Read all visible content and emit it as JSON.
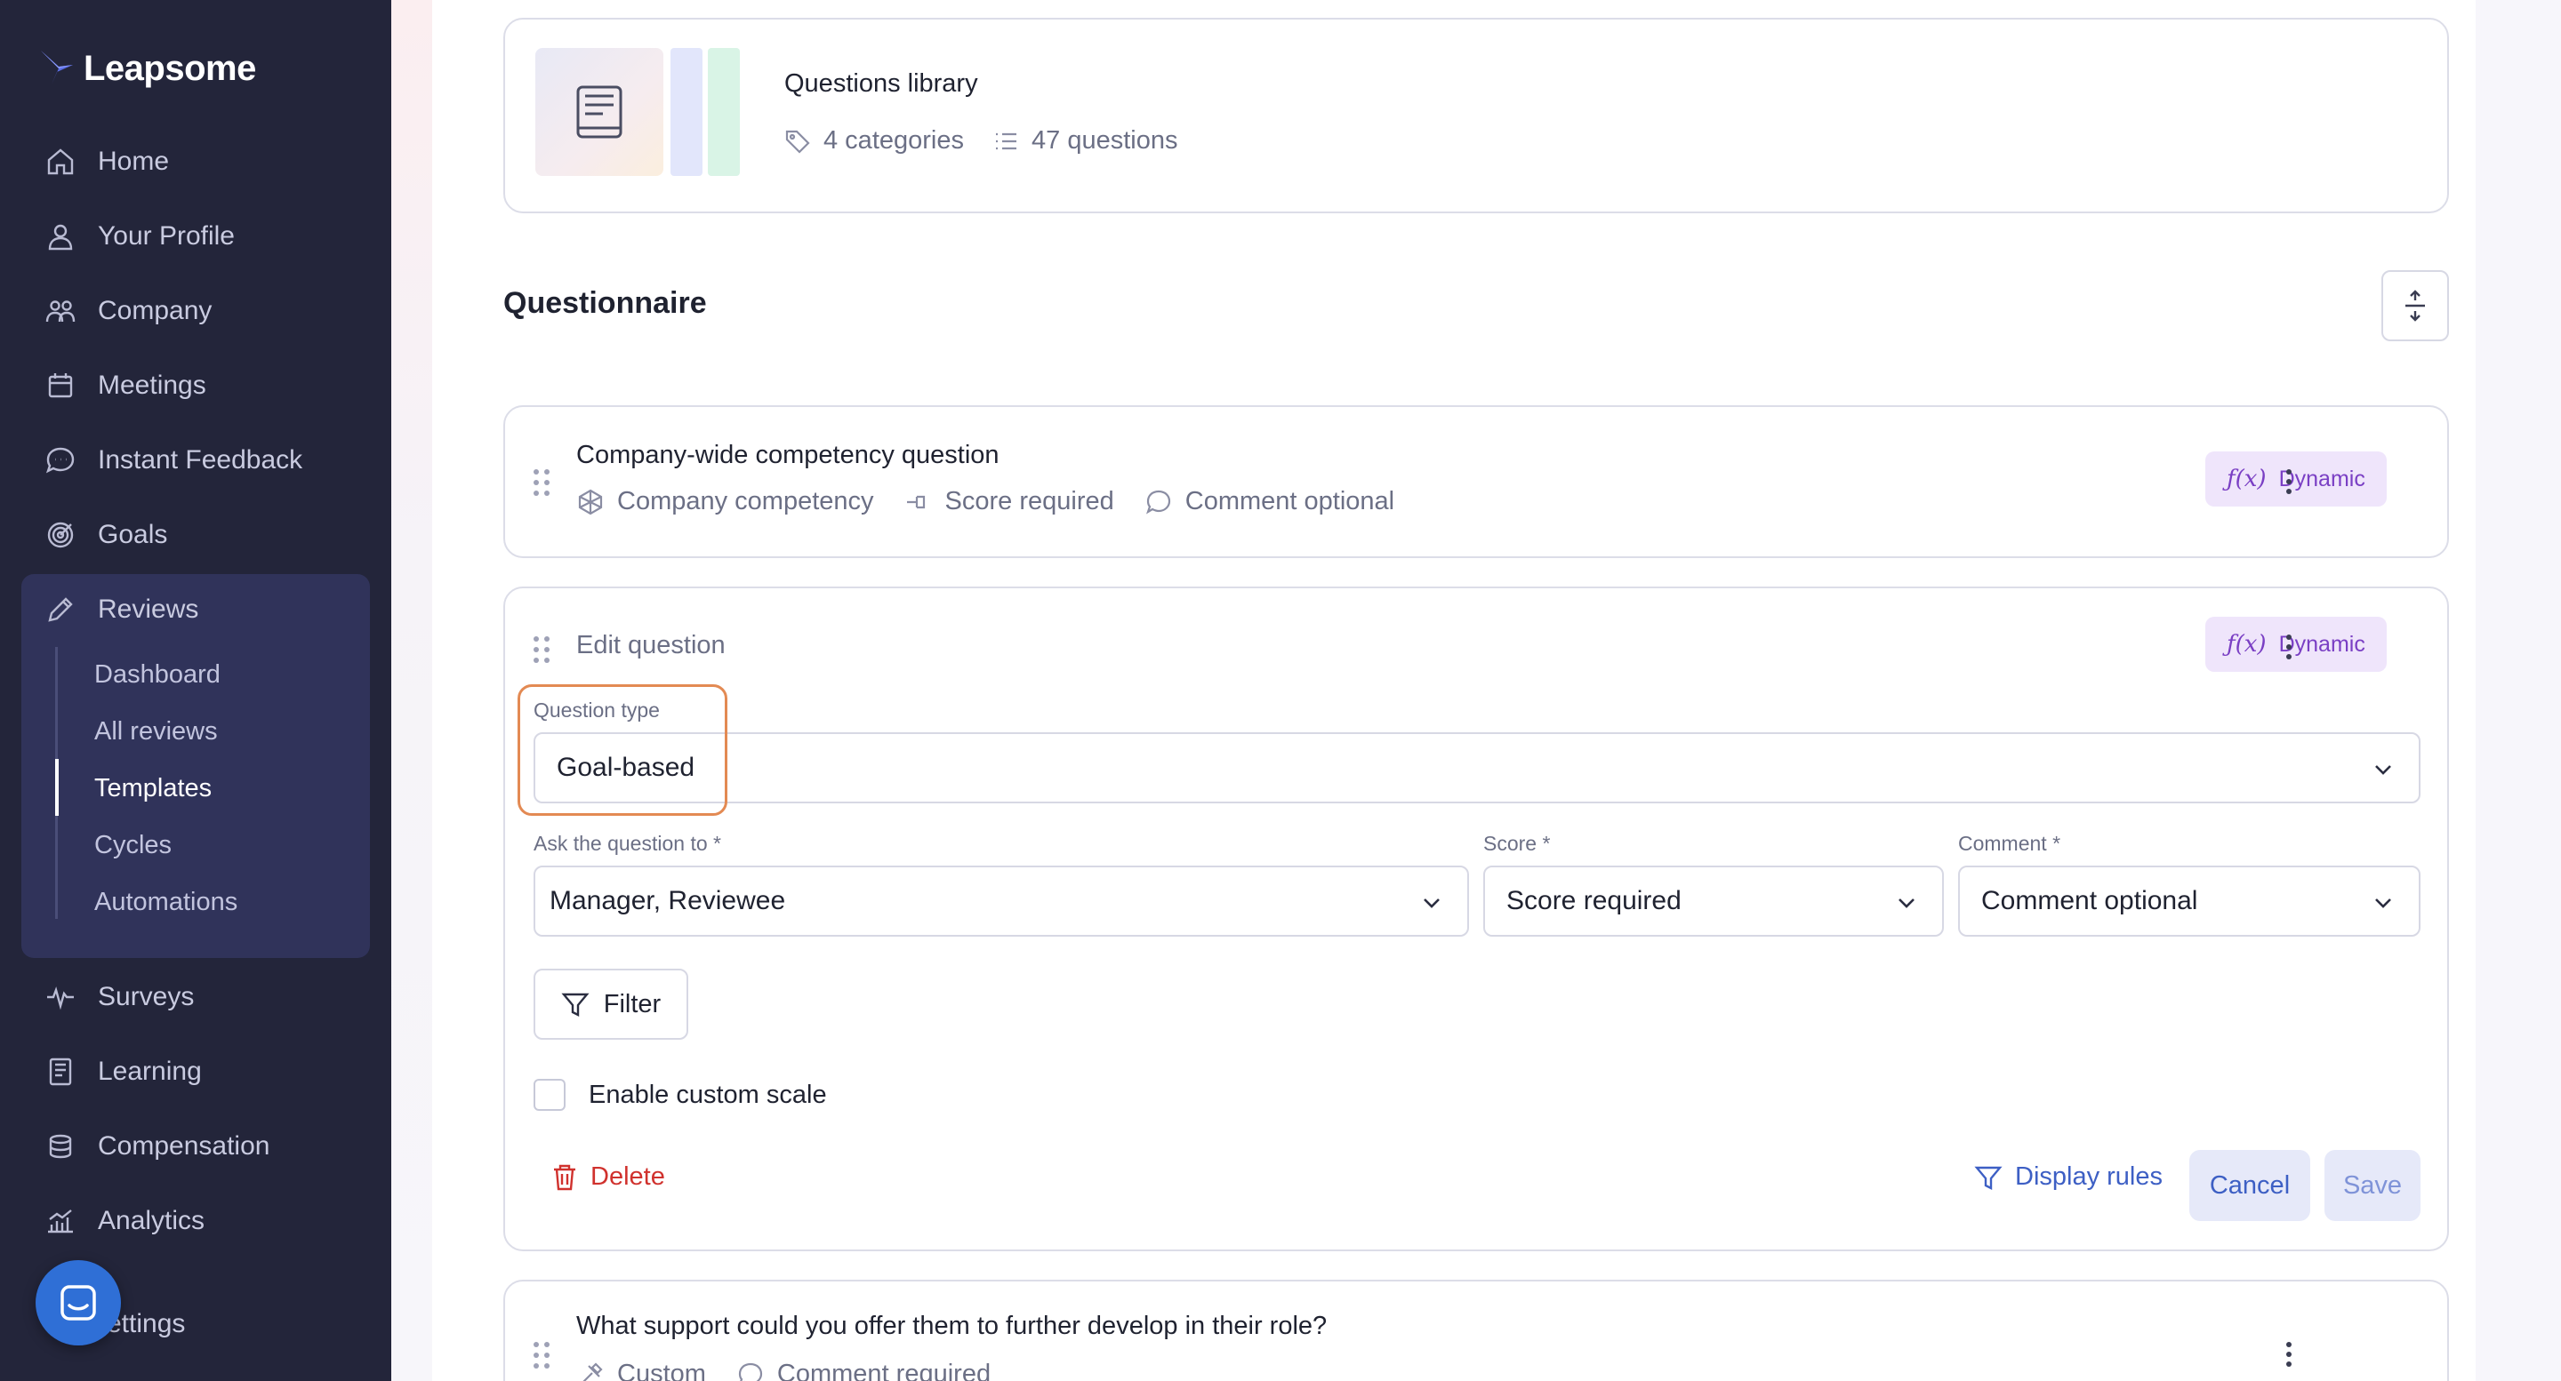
{
  "sidebar": {
    "logo": "Leapsome",
    "items": [
      {
        "label": "Home",
        "icon": "home-icon"
      },
      {
        "label": "Your Profile",
        "icon": "user-icon"
      },
      {
        "label": "Company",
        "icon": "people-icon"
      },
      {
        "label": "Meetings",
        "icon": "calendar-icon"
      },
      {
        "label": "Instant Feedback",
        "icon": "chat-icon"
      },
      {
        "label": "Goals",
        "icon": "target-icon"
      },
      {
        "label": "Reviews",
        "icon": "pencil-icon"
      },
      {
        "label": "Surveys",
        "icon": "pulse-icon"
      },
      {
        "label": "Learning",
        "icon": "book-icon"
      },
      {
        "label": "Compensation",
        "icon": "coins-icon"
      },
      {
        "label": "Analytics",
        "icon": "chart-icon"
      },
      {
        "label": "ettings",
        "icon": "gear-icon"
      }
    ],
    "reviews_sub": [
      {
        "label": "Dashboard"
      },
      {
        "label": "All reviews"
      },
      {
        "label": "Templates"
      },
      {
        "label": "Cycles"
      },
      {
        "label": "Automations"
      }
    ]
  },
  "library": {
    "title": "Questions library",
    "categories": "4 categories",
    "questions": "47 questions"
  },
  "questionnaire": {
    "title": "Questionnaire"
  },
  "question1": {
    "title": "Company-wide competency question",
    "meta1": "Company competency",
    "meta2": "Score required",
    "meta3": "Comment optional",
    "badge": "Dynamic"
  },
  "edit": {
    "header": "Edit question",
    "badge": "Dynamic",
    "type_label": "Question type",
    "type_value": "Goal-based",
    "ask_label": "Ask the question to *",
    "ask_value": "Manager, Reviewee",
    "score_label": "Score *",
    "score_value": "Score required",
    "comment_label": "Comment *",
    "comment_value": "Comment optional",
    "filter": "Filter",
    "custom_scale": "Enable custom scale",
    "delete": "Delete",
    "display_rules": "Display rules",
    "cancel": "Cancel",
    "save": "Save"
  },
  "question3": {
    "title": "What support could you offer them to further develop in their role?",
    "meta1": "Custom",
    "meta2": "Comment required"
  },
  "colors": {
    "sidebar_bg": "#23253a",
    "accent": "#3d5fc4",
    "dynamic": "#7a3fc4",
    "delete": "#d0312d",
    "highlight": "#e38a53"
  }
}
